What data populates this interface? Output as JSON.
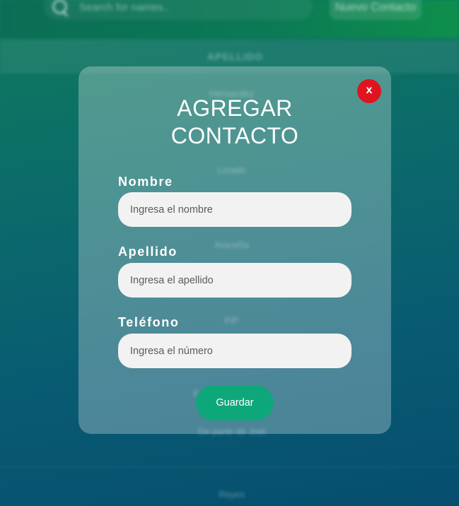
{
  "background": {
    "search": {
      "placeholder": "Search for names.."
    },
    "new_contact_label": "Nuevo Contacto",
    "table_header": "APELLIDO",
    "rows": [
      "Hernandez",
      "Lorado",
      "Araceña",
      "PiP",
      "E",
      "De parte de Joel",
      "Reyes"
    ]
  },
  "modal": {
    "close_label": "x",
    "title": "AGREGAR CONTACTO",
    "fields": [
      {
        "label": "Nombre",
        "placeholder": "Ingresa el nombre",
        "value": ""
      },
      {
        "label": "Apellido",
        "placeholder": "Ingresa el apellido",
        "value": ""
      },
      {
        "label": "Teléfono",
        "placeholder": "Ingresa el número",
        "value": ""
      }
    ],
    "save_label": "Guardar"
  },
  "colors": {
    "close": "#e0141e",
    "save": "#0ea77a",
    "input_bg": "#f2f2f2"
  }
}
